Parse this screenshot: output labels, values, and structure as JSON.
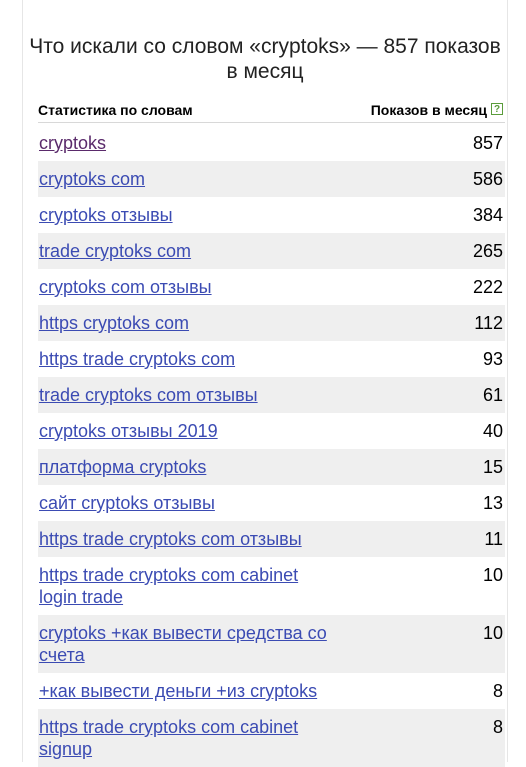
{
  "title": "Что искали со словом «cryptoks» — 857 показов в месяц",
  "header": {
    "left": "Статистика по словам",
    "right": "Показов в месяц",
    "help": "?"
  },
  "rows": [
    {
      "keyword": "cryptoks",
      "count": "857"
    },
    {
      "keyword": "cryptoks com",
      "count": "586"
    },
    {
      "keyword": "cryptoks отзывы",
      "count": "384"
    },
    {
      "keyword": "trade cryptoks com",
      "count": "265"
    },
    {
      "keyword": "cryptoks com отзывы",
      "count": "222"
    },
    {
      "keyword": "https cryptoks com",
      "count": "112"
    },
    {
      "keyword": "https trade cryptoks com",
      "count": "93"
    },
    {
      "keyword": "trade cryptoks com отзывы",
      "count": "61"
    },
    {
      "keyword": "cryptoks отзывы 2019",
      "count": "40"
    },
    {
      "keyword": "платформа cryptoks",
      "count": "15"
    },
    {
      "keyword": "сайт cryptoks отзывы",
      "count": "13"
    },
    {
      "keyword": "https trade cryptoks com отзывы",
      "count": "11"
    },
    {
      "keyword": "https trade cryptoks com cabinet login trade",
      "count": "10"
    },
    {
      "keyword": "cryptoks +как вывести средства со счета",
      "count": "10"
    },
    {
      "keyword": "+как вывести деньги +из cryptoks",
      "count": "8"
    },
    {
      "keyword": "https trade cryptoks com cabinet signup",
      "count": "8"
    }
  ]
}
